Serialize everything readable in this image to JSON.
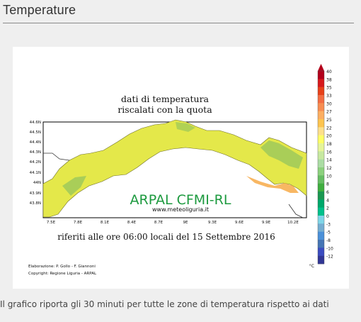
{
  "header": {
    "title": "Temperature"
  },
  "map": {
    "title_line1": "dati di temperatura",
    "title_line2": "riscalati con la quota",
    "watermark": "ARPAL CFMI-RL",
    "website": "www.meteoliguria.it",
    "footer_line": "riferiti alle ore 06:00 locali del 15 Settembre 2016",
    "credit_elaboration": "Elaborazione: P. Gollo - F. Giannoni",
    "credit_copyright": "Copyright: Regione Liguria - ARPAL",
    "x_ticks": [
      "7.5E",
      "7.8E",
      "8.1E",
      "8.4E",
      "8.7E",
      "9E",
      "9.3E",
      "9.6E",
      "9.9E",
      "10.2E"
    ],
    "y_ticks": [
      "44.6N",
      "44.5N",
      "44.4N",
      "44.3N",
      "44.2N",
      "44.1N",
      "44N",
      "43.9N",
      "43.8N"
    ],
    "legend_unit": "°C",
    "legend_labels": [
      "40",
      "38",
      "35",
      "33",
      "30",
      "27",
      "25",
      "22",
      "20",
      "18",
      "16",
      "14",
      "12",
      "10",
      "8",
      "6",
      "4",
      "2",
      "0",
      "-3",
      "-5",
      "-8",
      "-10",
      "-12"
    ],
    "legend_colors": [
      "#b3001b",
      "#d7191c",
      "#e8411a",
      "#f46d43",
      "#f88d52",
      "#fdae61",
      "#fec44f",
      "#fee08b",
      "#ffff66",
      "#e6f598",
      "#c7e9a0",
      "#abdda4",
      "#8cd17d",
      "#66bd63",
      "#3fae3f",
      "#1a9850",
      "#00a86b",
      "#00c08a",
      "#7fd6e8",
      "#74add1",
      "#4a90d9",
      "#4575b4",
      "#3b4cc0",
      "#313695"
    ],
    "land_color": "#e4e84a",
    "land_green": "#9fc95a"
  },
  "caption": {
    "text": "Il grafico riporta gli 30 minuti per tutte le zone di temperatura rispetto ai dati"
  }
}
